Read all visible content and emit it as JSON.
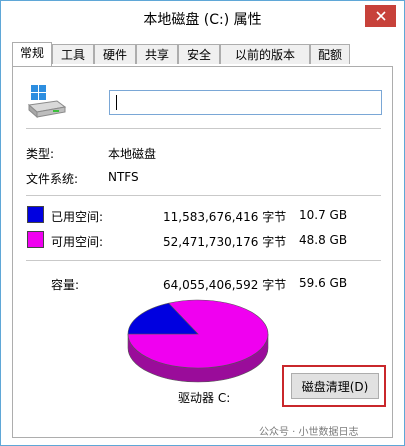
{
  "window": {
    "title": "本地磁盘 (C:) 属性"
  },
  "tabs": [
    "常规",
    "工具",
    "硬件",
    "共享",
    "安全",
    "以前的版本",
    "配额"
  ],
  "name_field": {
    "value": ""
  },
  "type": {
    "label": "类型:",
    "value": "本地磁盘"
  },
  "filesystem": {
    "label": "文件系统:",
    "value": "NTFS"
  },
  "used": {
    "label": "已用空间:",
    "bytes": "11,583,676,416 字节",
    "size": "10.7 GB",
    "color": "#0000e0"
  },
  "free": {
    "label": "可用空间:",
    "bytes": "52,471,730,176 字节",
    "size": "48.8 GB",
    "color": "#f000f0"
  },
  "capacity": {
    "label": "容量:",
    "bytes": "64,055,406,592 字节",
    "size": "59.6 GB"
  },
  "usage_fraction": 0.181,
  "drive_label": "驱动器 C:",
  "cleanup_button": "磁盘清理(D)",
  "watermark": "公众号 · 小世数据日志"
}
